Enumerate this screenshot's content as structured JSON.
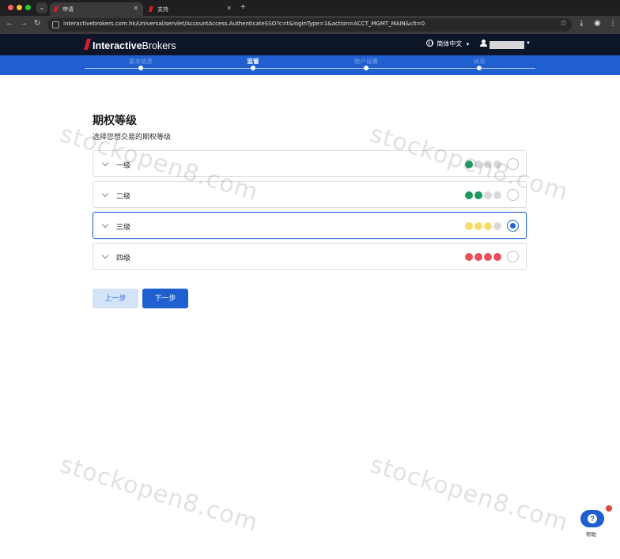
{
  "browser": {
    "tabs": [
      {
        "title": "申请",
        "active": true
      },
      {
        "title": "支持",
        "active": false
      }
    ],
    "url": "interactivebrokers.com.hk/Universal/servlet/AccountAccess.AuthenticateSSO?c=t&loginType=1&action=ACCT_MGMT_MAIN&clt=0"
  },
  "header": {
    "logo_bold": "Interactive",
    "logo_rest": "Brokers",
    "language": "简体中文",
    "caret": "▼"
  },
  "steps": [
    {
      "label": "基本信息",
      "active": false
    },
    {
      "label": "监管",
      "active": true
    },
    {
      "label": "账户设置",
      "active": false
    },
    {
      "label": "状态",
      "active": false
    }
  ],
  "main": {
    "title": "期权等级",
    "subtitle": "选择您想交易的期权等级",
    "levels": [
      {
        "label": "一级",
        "filled": 1,
        "color": "#1c9a5e",
        "selected": false
      },
      {
        "label": "二级",
        "filled": 2,
        "color": "#1c9a5e",
        "selected": false
      },
      {
        "label": "三级",
        "filled": 3,
        "color": "#f7dc6b",
        "selected": true
      },
      {
        "label": "四级",
        "filled": 4,
        "color": "#e8505b",
        "selected": false
      }
    ],
    "empty_dot_color": "#d9d9d9",
    "buttons": {
      "prev": "上一步",
      "next": "下一步"
    }
  },
  "watermark": "stockopen8.com",
  "help": {
    "label": "帮助",
    "icon_glyph": "?"
  },
  "colors": {
    "brand_blue": "#1f5fcf",
    "header_navy": "#0c1628"
  }
}
